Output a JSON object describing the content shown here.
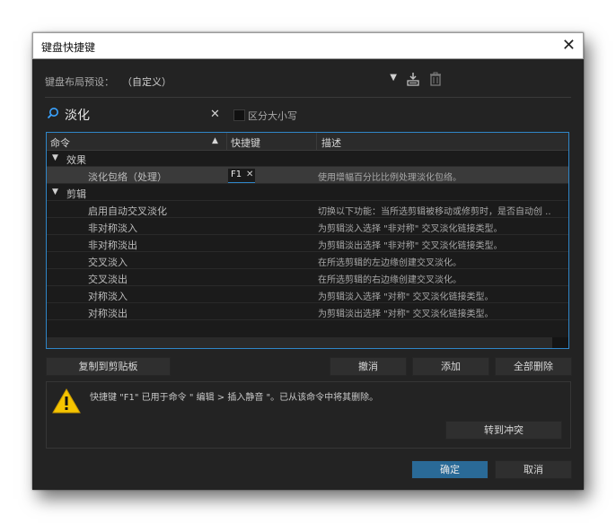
{
  "window": {
    "title": "键盘快捷键"
  },
  "preset": {
    "label": "键盘布局预设：",
    "value": "（自定义）"
  },
  "search": {
    "value": "淡化",
    "case_label": "区分大小写"
  },
  "table": {
    "headers": {
      "command": "命令",
      "shortcut": "快捷键",
      "description": "描述"
    },
    "groups": [
      {
        "label": "效果"
      },
      {
        "label": "剪辑"
      }
    ],
    "rows": [
      {
        "command": "淡化包络（处理）",
        "shortcut": "F1",
        "description": "使用增幅百分比比例处理淡化包络。"
      },
      {
        "command": "启用自动交叉淡化",
        "shortcut": "",
        "description": "切换以下功能：当所选剪辑被移动或修剪时，是否自动创 .."
      },
      {
        "command": "非对称淡入",
        "shortcut": "",
        "description": "为剪辑淡入选择 \"非对称\" 交叉淡化链接类型。"
      },
      {
        "command": "非对称淡出",
        "shortcut": "",
        "description": "为剪辑淡出选择 \"非对称\" 交叉淡化链接类型。"
      },
      {
        "command": "交叉淡入",
        "shortcut": "",
        "description": "在所选剪辑的左边缘创建交叉淡化。"
      },
      {
        "command": "交叉淡出",
        "shortcut": "",
        "description": "在所选剪辑的右边缘创建交叉淡化。"
      },
      {
        "command": "对称淡入",
        "shortcut": "",
        "description": "为剪辑淡入选择 \"对称\" 交叉淡化链接类型。"
      },
      {
        "command": "对称淡出",
        "shortcut": "",
        "description": "为剪辑淡出选择 \"对称\" 交叉淡化链接类型。"
      }
    ]
  },
  "buttons": {
    "copy": "复制到剪贴板",
    "undo": "撤消",
    "add": "添加",
    "delete_all": "全部删除",
    "goto_conflict": "转到冲突",
    "ok": "确定",
    "cancel": "取消"
  },
  "warning": {
    "text": "快捷键 \"F1\" 已用于命令 \" 编辑 > 插入静音 \"。已从该命令中将其删除。"
  },
  "colors": {
    "accent": "#2f86c8",
    "primary_button": "#2a6a97",
    "warning": "#f5c400"
  }
}
